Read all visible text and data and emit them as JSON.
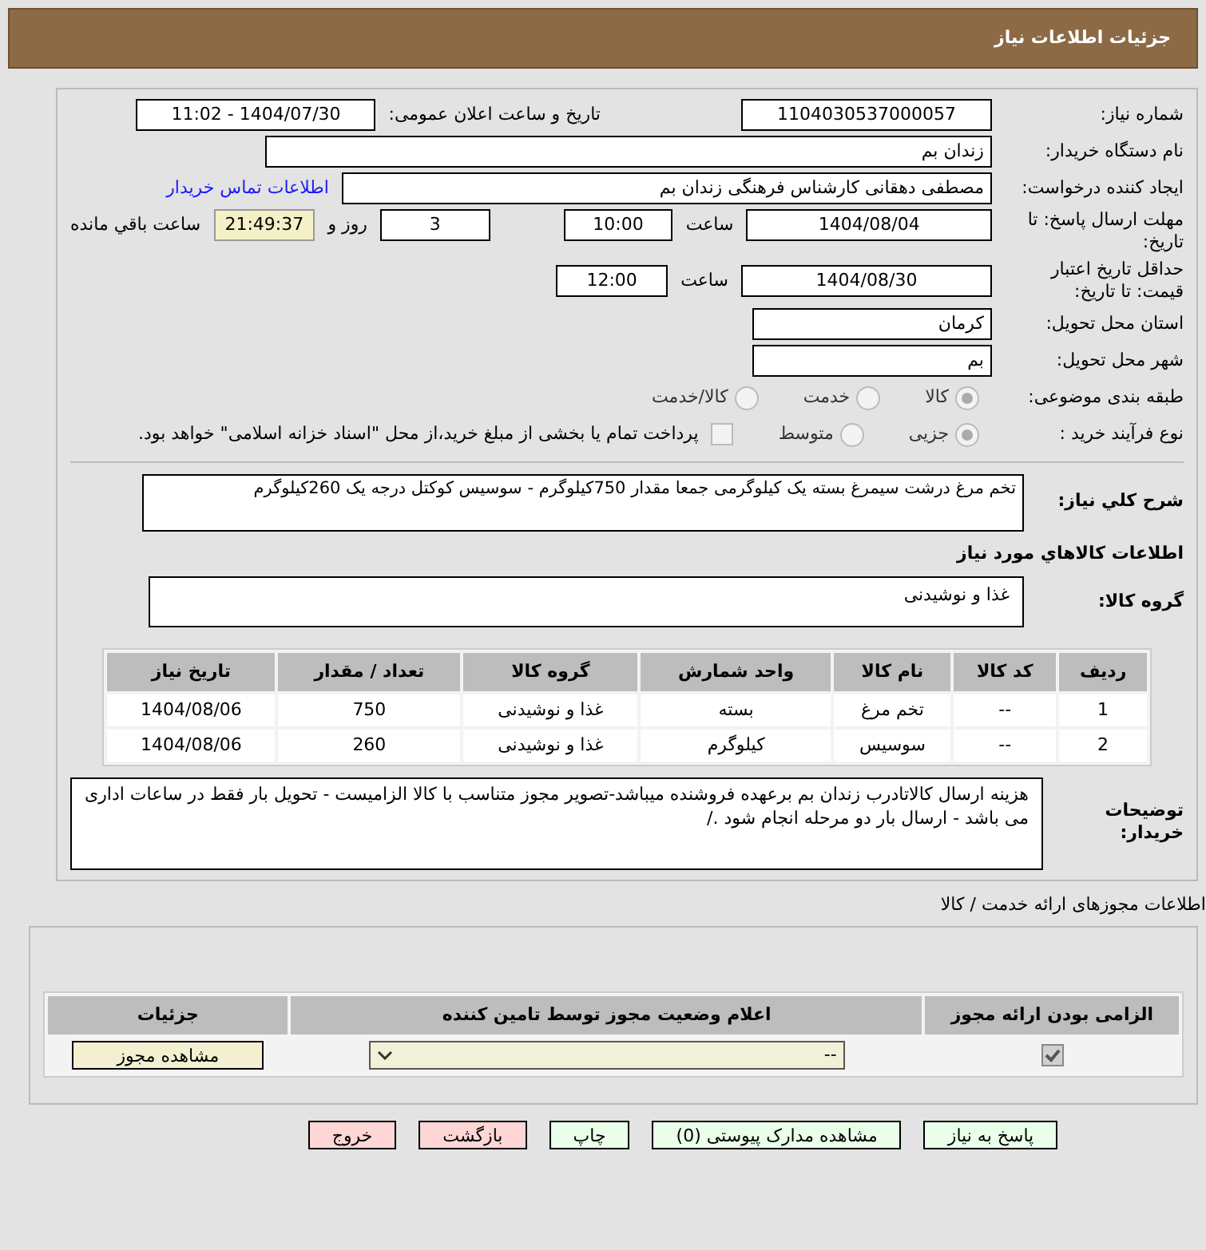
{
  "header": {
    "title": "جزئیات اطلاعات نیاز"
  },
  "need_number": {
    "label": "شماره نیاز:",
    "value": "1104030537000057"
  },
  "announce": {
    "label": "تاریخ و ساعت اعلان عمومی:",
    "value": "1404/07/30 - 11:02"
  },
  "buyer": {
    "label": "نام دستگاه خریدار:",
    "value": "زندان بم"
  },
  "creator": {
    "label": "ایجاد کننده درخواست:",
    "value": "مصطفی دهقانی کارشناس فرهنگی زندان بم",
    "link": "اطلاعات تماس خریدار"
  },
  "deadline": {
    "label": "مهلت ارسال پاسخ: تا تاریخ:",
    "date": "1404/08/04",
    "time_label": "ساعت",
    "time": "10:00",
    "days": "3",
    "days_label": "روز و",
    "remaining": "21:49:37",
    "remaining_label": "ساعت باقي مانده"
  },
  "validity": {
    "label": "حداقل تاریخ اعتبار قیمت: تا تاریخ:",
    "date": "1404/08/30",
    "time_label": "ساعت",
    "time": "12:00"
  },
  "province": {
    "label": "استان محل تحویل:",
    "value": "کرمان"
  },
  "city": {
    "label": "شهر محل تحویل:",
    "value": "بم"
  },
  "category": {
    "label": "طبقه بندی موضوعی:",
    "options": [
      {
        "label": "کالا",
        "selected": true
      },
      {
        "label": "خدمت",
        "selected": false
      },
      {
        "label": "کالا/خدمت",
        "selected": false
      }
    ]
  },
  "process": {
    "label": "نوع فرآیند خرید :",
    "options": [
      {
        "label": "جزیی",
        "selected": true
      },
      {
        "label": "متوسط",
        "selected": false
      }
    ],
    "payment": {
      "label": "پرداخت تمام یا بخشی از مبلغ خرید،از محل \"اسناد خزانه اسلامی\" خواهد بود.",
      "checked": false
    }
  },
  "description": {
    "label": "شرح كلي نياز:",
    "value": "تخم مرغ درشت سیمرغ بسته یک کیلوگرمی جمعا مقدار 750کیلوگرم - سوسیس کوکتل درجه یک 260کیلوگرم"
  },
  "goods_title": "اطلاعات كالاهاي مورد نياز",
  "goods_group": {
    "label": "گروه کالا:",
    "value": "غذا و نوشیدنی"
  },
  "items": {
    "columns": [
      "ردیف",
      "کد کالا",
      "نام کالا",
      "واحد شمارش",
      "گروه کالا",
      "تعداد / مقدار",
      "تاریخ نیاز"
    ],
    "rows": [
      [
        "1",
        "--",
        "تخم مرغ",
        "بسته",
        "غذا و نوشیدنی",
        "750",
        "1404/08/06"
      ],
      [
        "2",
        "--",
        "سوسیس",
        "کیلوگرم",
        "غذا و نوشیدنی",
        "260",
        "1404/08/06"
      ]
    ]
  },
  "buyer_notes": {
    "label": "توضیحات خریدار:",
    "value": "هزینه ارسال کالاتادرب زندان بم برعهده فروشنده میباشد-تصویر مجوز متناسب با کالا الزامیست - تحویل بار فقط در ساعات اداری می باشد - ارسال بار دو مرحله انجام شود ./"
  },
  "permits": {
    "title": "اطلاعات مجوزهای ارائه خدمت / کالا",
    "columns": [
      "الزامی بودن ارائه مجوز",
      "اعلام وضعیت مجوز توسط تامین کننده",
      "جزئیات"
    ],
    "rows": [
      {
        "required": true,
        "status": "--",
        "button": "مشاهده مجوز"
      }
    ]
  },
  "buttons": [
    {
      "label": "پاسخ به نیاز",
      "kind": "green"
    },
    {
      "label": "مشاهده مدارک پیوستی (0)",
      "kind": "green"
    },
    {
      "label": "چاپ",
      "kind": "green"
    },
    {
      "label": "بازگشت",
      "kind": "red"
    },
    {
      "label": "خروج",
      "kind": "red"
    }
  ]
}
